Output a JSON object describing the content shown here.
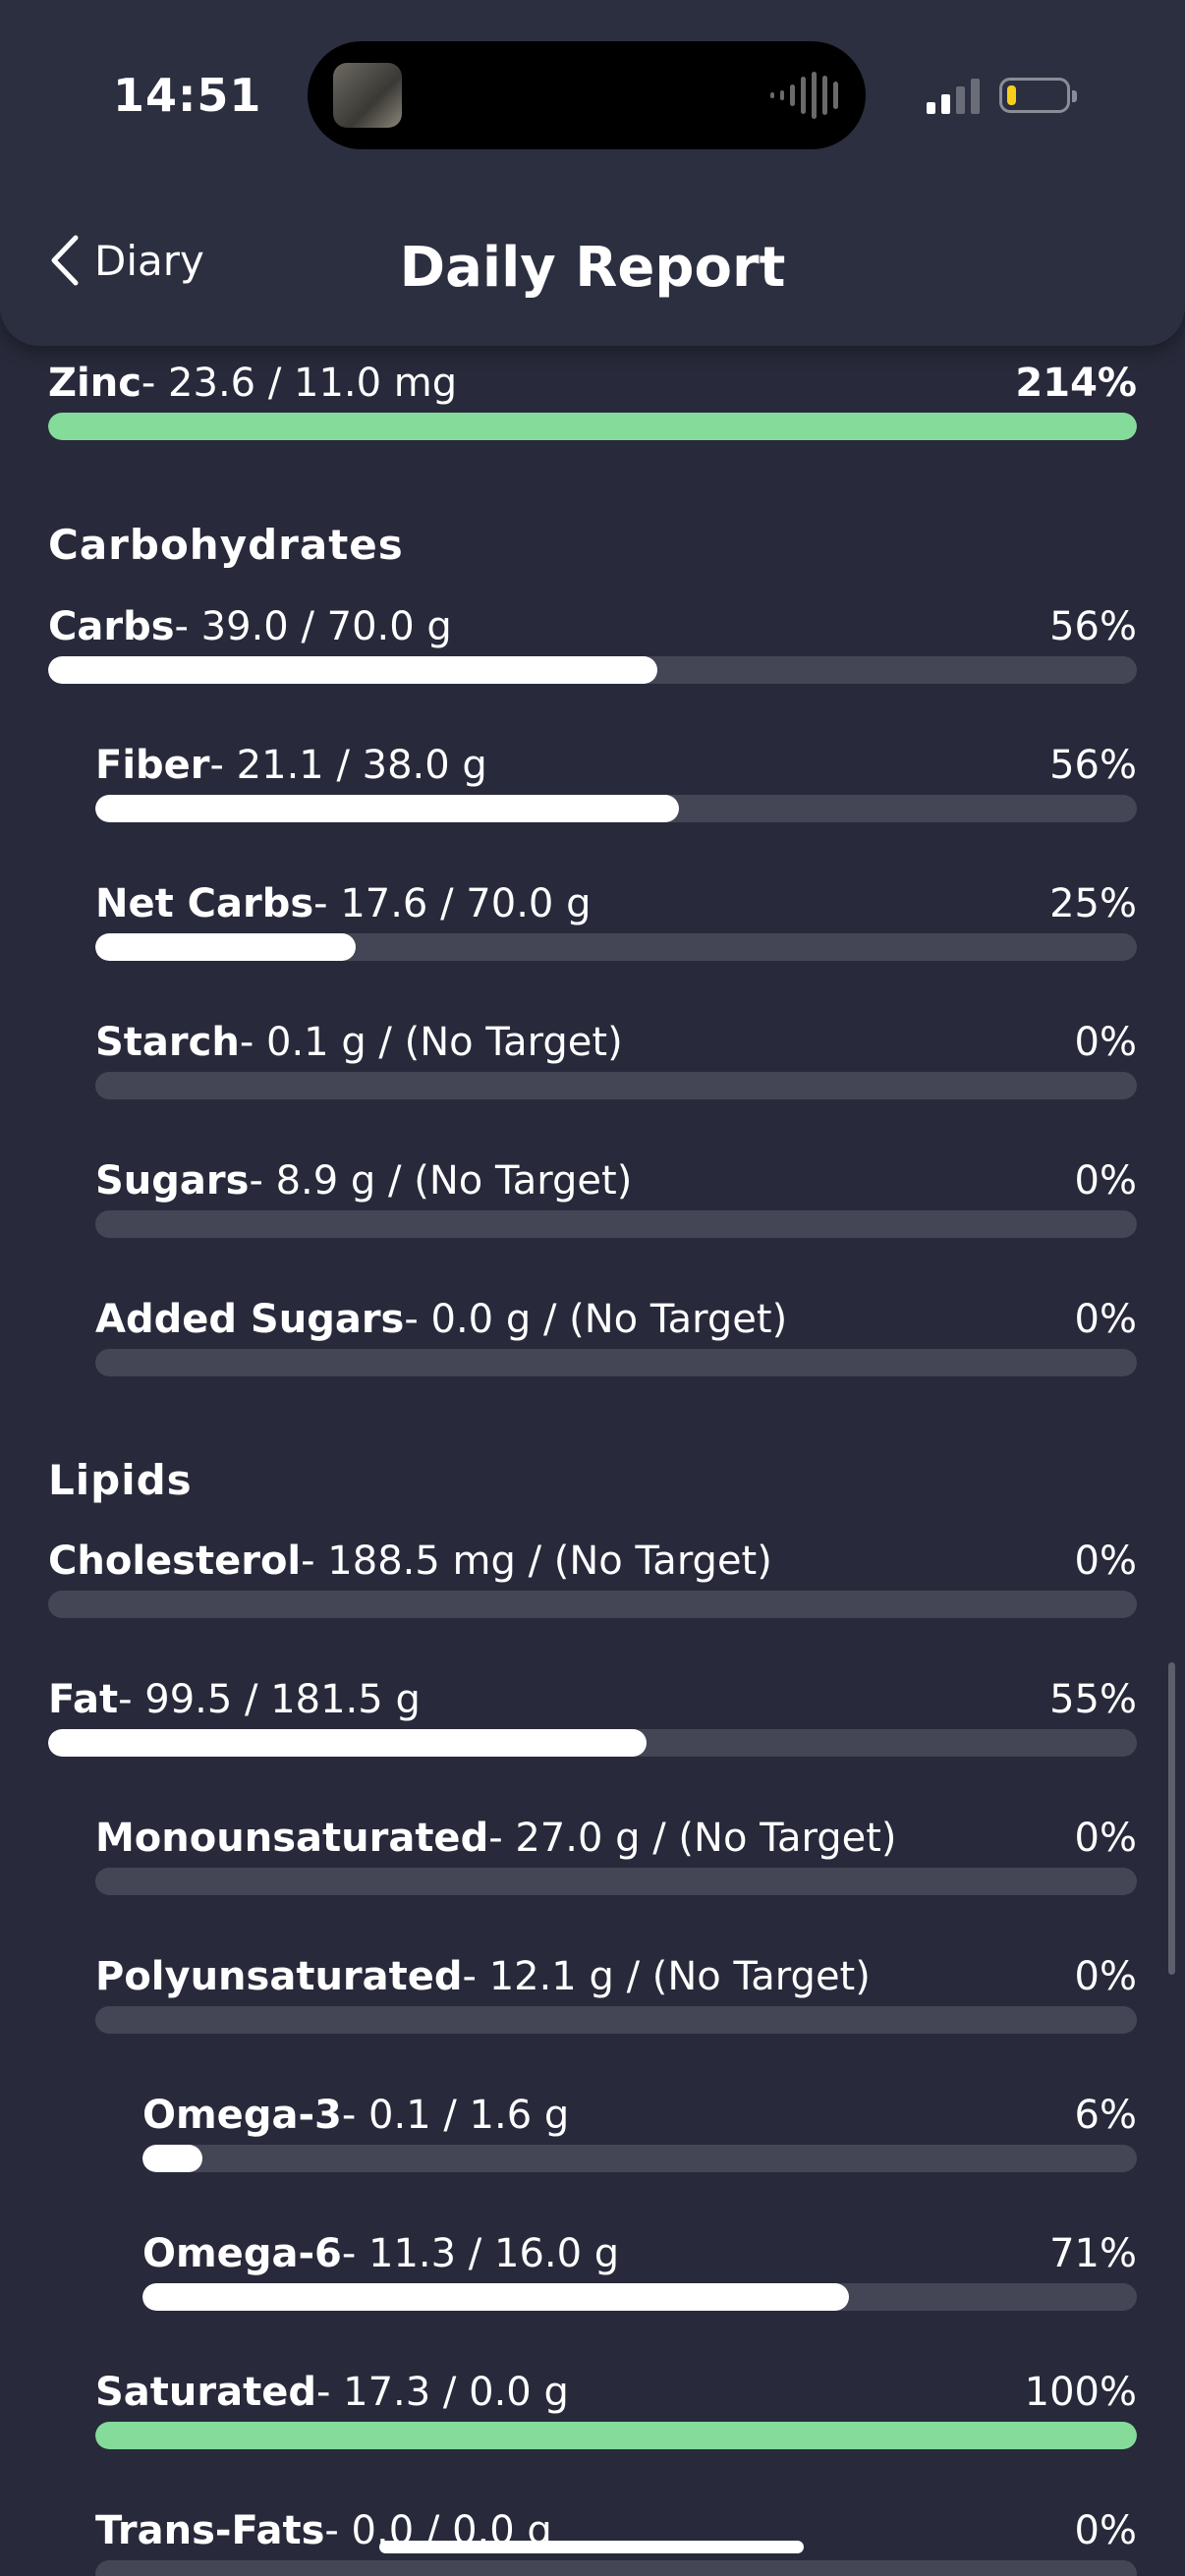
{
  "status_bar": {
    "time": "14:51",
    "battery_level": 0.15
  },
  "header": {
    "back_label": "Diary",
    "title": "Daily Report"
  },
  "colors": {
    "accent_green": "#85dc9a",
    "fill_white": "#ffffff",
    "track": "#444655",
    "background": "#282a3b"
  },
  "sections": {
    "carbohydrates": "Carbohydrates",
    "lipids": "Lipids"
  },
  "nutrients": {
    "zinc": {
      "name": "Zinc",
      "detail": "- 23.6 / 11.0 mg",
      "pct": "214%",
      "fraction": 1.0,
      "status": "complete"
    },
    "carbs": {
      "name": "Carbs",
      "detail": "- 39.0 / 70.0 g",
      "pct": "56%",
      "fraction": 0.56,
      "status": "partial"
    },
    "fiber": {
      "name": "Fiber",
      "detail": "- 21.1 / 38.0 g",
      "pct": "56%",
      "fraction": 0.56,
      "status": "partial"
    },
    "net_carbs": {
      "name": "Net Carbs",
      "detail": "- 17.6 / 70.0 g",
      "pct": "25%",
      "fraction": 0.25,
      "status": "partial"
    },
    "starch": {
      "name": "Starch",
      "detail": "- 0.1 g / (No Target)",
      "pct": "0%",
      "fraction": 0,
      "status": "none"
    },
    "sugars": {
      "name": "Sugars",
      "detail": "- 8.9 g / (No Target)",
      "pct": "0%",
      "fraction": 0,
      "status": "none"
    },
    "added_sugars": {
      "name": "Added Sugars",
      "detail": "- 0.0 g / (No Target)",
      "pct": "0%",
      "fraction": 0,
      "status": "none"
    },
    "cholesterol": {
      "name": "Cholesterol",
      "detail": "- 188.5 mg / (No Target)",
      "pct": "0%",
      "fraction": 0,
      "status": "none"
    },
    "fat": {
      "name": "Fat",
      "detail": "- 99.5 / 181.5 g",
      "pct": "55%",
      "fraction": 0.55,
      "status": "partial"
    },
    "monounsaturated": {
      "name": "Monounsaturated",
      "detail": "- 27.0 g / (No Target)",
      "pct": "0%",
      "fraction": 0,
      "status": "none"
    },
    "polyunsaturated": {
      "name": "Polyunsaturated",
      "detail": "- 12.1 g / (No Target)",
      "pct": "0%",
      "fraction": 0,
      "status": "none"
    },
    "omega3": {
      "name": "Omega-3",
      "detail": "- 0.1 / 1.6 g",
      "pct": "6%",
      "fraction": 0.06,
      "status": "partial"
    },
    "omega6": {
      "name": "Omega-6",
      "detail": "- 11.3 / 16.0 g",
      "pct": "71%",
      "fraction": 0.71,
      "status": "partial"
    },
    "saturated": {
      "name": "Saturated",
      "detail": "- 17.3 / 0.0 g",
      "pct": "100%",
      "fraction": 1.0,
      "status": "complete"
    },
    "trans_fats": {
      "name": "Trans-Fats",
      "detail": "- 0.0 / 0.0 g",
      "pct": "0%",
      "fraction": 0,
      "status": "none"
    }
  }
}
